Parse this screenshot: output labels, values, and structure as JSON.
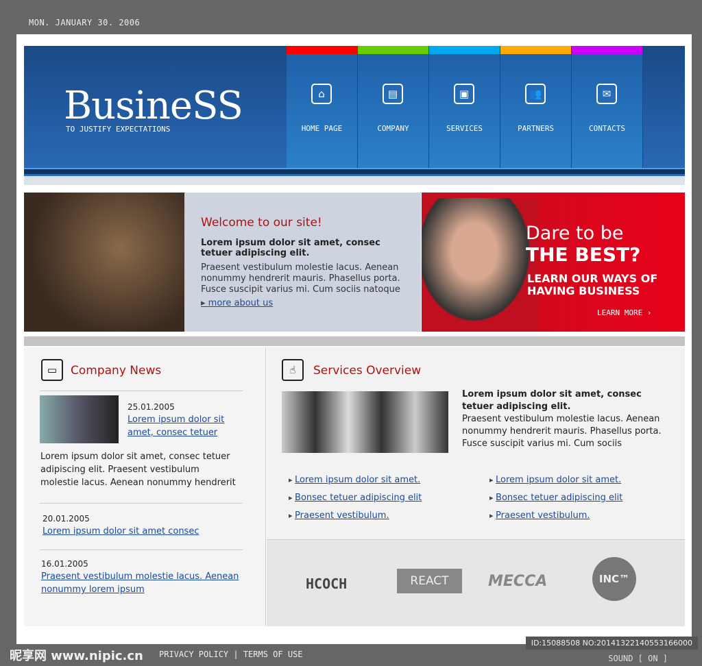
{
  "date": "MON. JANUARY 30. 2006",
  "header": {
    "logo": "BusineSS",
    "tagline": "TO JUSTIFY EXPECTATIONS",
    "nav": [
      {
        "label": "HOME PAGE",
        "color": "#ff0000",
        "icon": "⌂"
      },
      {
        "label": "COMPANY",
        "color": "#66cc00",
        "icon": "▤"
      },
      {
        "label": "SERVICES",
        "color": "#00aaee",
        "icon": "▣"
      },
      {
        "label": "PARTNERS",
        "color": "#ffaa00",
        "icon": "👥"
      },
      {
        "label": "CONTACTS",
        "color": "#cc00ff",
        "icon": "✉"
      }
    ]
  },
  "welcome": {
    "title": "Welcome to our site!",
    "bold": "Lorem ipsum dolor sit amet, consec tetuer adipiscing elit.",
    "text": "Praesent vestibulum molestie lacus. Aenean nonummy hendrerit mauris. Phasellus porta. Fusce suscipit varius mi. Cum sociis natoque",
    "link": "more about us"
  },
  "promo": {
    "line1": "Dare to be",
    "line2": "THE BEST?",
    "line3": "LEARN OUR WAYS OF HAVING BUSINESS",
    "more": "LEARN MORE"
  },
  "news": {
    "title": "Company News",
    "items": [
      {
        "date": "25.01.2005",
        "link": "Lorem ipsum dolor sit amet, consec tetuer",
        "text": "Lorem ipsum dolor sit amet, consec tetuer adipiscing elit. Praesent vestibulum molestie lacus. Aenean nonummy hendrerit"
      },
      {
        "date": "20.01.2005",
        "link": "Lorem ipsum dolor sit amet consec"
      },
      {
        "date": "16.01.2005",
        "link": "Praesent vestibulum molestie lacus. Aenean nonummy lorem ipsum"
      }
    ]
  },
  "services": {
    "title": "Services Overview",
    "bold": "Lorem ipsum dolor sit amet, consec tetuer adipiscing elit.",
    "text": "Praesent vestibulum molestie lacus. Aenean nonummy hendrerit mauris. Phasellus porta. Fusce suscipit varius mi. Cum sociis",
    "links_left": [
      "Lorem ipsum dolor sit amet.",
      "Bonsec tetuer adipiscing elit",
      "Praesent vestibulum."
    ],
    "links_right": [
      "Lorem ipsum dolor sit amet.",
      "Bonsec tetuer adipiscing elit",
      "Praesent vestibulum."
    ]
  },
  "partners": [
    "HCOCH",
    "REACT",
    "MECCA",
    "INC™"
  ],
  "footer": {
    "links": "PRIVACY POLICY | TERMS OF USE",
    "sound": "SOUND [ ON ]"
  },
  "watermark": {
    "site": "昵享网 www.nipic.cn",
    "id": "ID:15088508 NO:20141322140553166000"
  }
}
